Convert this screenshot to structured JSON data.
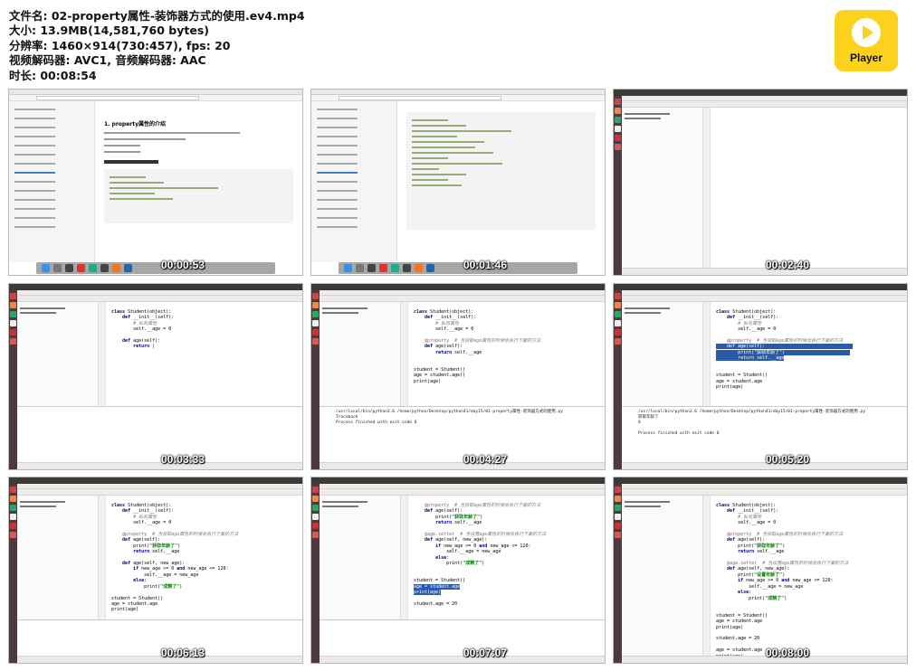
{
  "meta": {
    "filename": "文件名: 02-property属性-装饰器方式的使用.ev4.mp4",
    "size": "大小: 13.9MB(14,581,760 bytes)",
    "resolution": "分辨率: 1460×914(730:457), fps: 20",
    "codec": "视频解码器: AVC1, 音频解码器: AAC",
    "duration": "时长: 00:08:54"
  },
  "player_logo": {
    "label": "Player",
    "color": "#fcd21c"
  },
  "thumbnails": [
    {
      "timestamp": "00:00:53",
      "kind": "browser",
      "heading": "1. property属性的介绍"
    },
    {
      "timestamp": "00:01:46",
      "kind": "browser",
      "heading": ""
    },
    {
      "timestamp": "00:02:40",
      "kind": "pycharm"
    },
    {
      "timestamp": "00:03:33",
      "kind": "pycharm"
    },
    {
      "timestamp": "00:04:27",
      "kind": "pycharm"
    },
    {
      "timestamp": "00:05:20",
      "kind": "pycharm"
    },
    {
      "timestamp": "00:06:13",
      "kind": "pycharm"
    },
    {
      "timestamp": "00:07:07",
      "kind": "pycharm"
    },
    {
      "timestamp": "00:08:00",
      "kind": "pycharm"
    }
  ],
  "run_output": {
    "command": "/usr/local/bin/python3.6 /home/python/Desktop/python41/day15/01-property属性-装饰器方式的使用.py",
    "finished": "Process finished with exit code 0"
  }
}
